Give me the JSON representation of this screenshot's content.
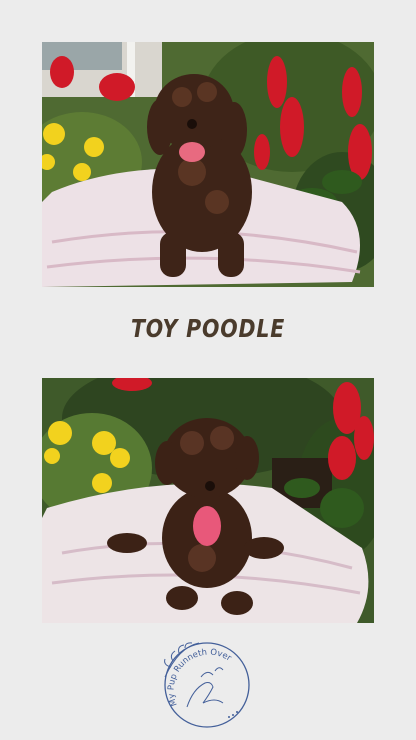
{
  "title": "TOY POODLE",
  "photos": [
    {
      "name": "puppy-photo-top",
      "alt": "Chocolate toy poodle puppy sitting on a white cushion in a garden"
    },
    {
      "name": "puppy-photo-bottom",
      "alt": "Chocolate toy poodle puppy lying on a white cushion in a garden"
    }
  ],
  "logo": {
    "text": "My Pup Runneth Over",
    "icon": "hand-and-paw-logo"
  },
  "colors": {
    "background": "#ececec",
    "title": "#4a3b2c",
    "logo": "#44609a"
  }
}
